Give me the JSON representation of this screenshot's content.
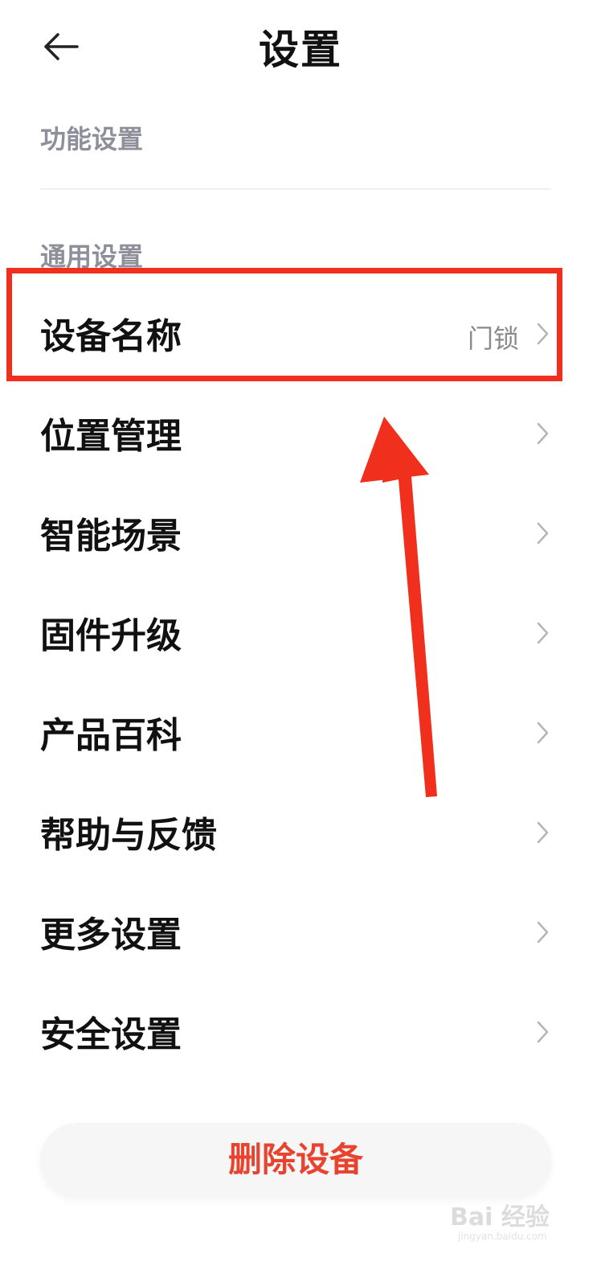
{
  "header": {
    "title": "设置",
    "back_icon": "arrow-left-icon"
  },
  "sections": {
    "function_label": "功能设置",
    "general_label": "通用设置"
  },
  "rows": [
    {
      "label": "设备名称",
      "value": "门锁"
    },
    {
      "label": "位置管理"
    },
    {
      "label": "智能场景"
    },
    {
      "label": "固件升级"
    },
    {
      "label": "产品百科"
    },
    {
      "label": "帮助与反馈"
    },
    {
      "label": "更多设置"
    },
    {
      "label": "安全设置"
    }
  ],
  "delete_button": {
    "label": "删除设备"
  },
  "watermark": {
    "logo_text": "Bai 经验",
    "site": "jingyan.baidu.com"
  },
  "colors": {
    "accent_red": "#f0301c",
    "delete_text": "#e8432e",
    "section_label": "#8d909a"
  }
}
